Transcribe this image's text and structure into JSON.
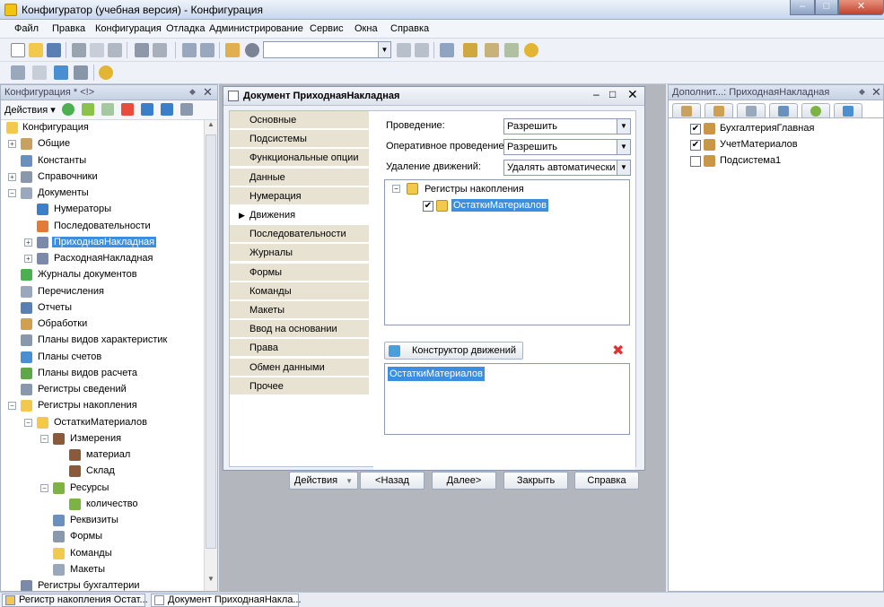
{
  "app": {
    "title": "Конфигуратор (учебная версия) - Конфигурация"
  },
  "window_controls": {
    "minimize": "–",
    "maximize": "□",
    "close": "✕"
  },
  "menu": [
    "Файл",
    "Правка",
    "Конфигурация",
    "Отладка",
    "Администрирование",
    "Сервис",
    "Окна",
    "Справка"
  ],
  "colors": {
    "selection": "#3b8ee0",
    "tab_bg": "#e8e2d2",
    "workspace": "#b3b7bd"
  },
  "left_panel": {
    "title": "Конфигурация * <!>",
    "pin": "◆",
    "close": "✕",
    "actions_label": "Действия ▾",
    "tree": [
      {
        "label": "Конфигурация",
        "icon": "config-icon",
        "exp": ""
      },
      {
        "label": "Общие",
        "icon": "common-icon",
        "exp": "+"
      },
      {
        "label": "Константы",
        "icon": "constants-icon",
        "exp": ""
      },
      {
        "label": "Справочники",
        "icon": "catalogs-icon",
        "exp": "+"
      },
      {
        "label": "Документы",
        "icon": "documents-icon",
        "exp": "−"
      },
      {
        "label": "Нумераторы",
        "icon": "numerators-icon",
        "exp": ""
      },
      {
        "label": "Последовательности",
        "icon": "sequences-icon",
        "exp": ""
      },
      {
        "label": "ПриходнаяНакладная",
        "icon": "document-icon",
        "exp": "+",
        "selected": true
      },
      {
        "label": "РасходнаяНакладная",
        "icon": "document-icon",
        "exp": "+"
      },
      {
        "label": "Журналы документов",
        "icon": "journals-icon",
        "exp": ""
      },
      {
        "label": "Перечисления",
        "icon": "enums-icon",
        "exp": ""
      },
      {
        "label": "Отчеты",
        "icon": "reports-icon",
        "exp": ""
      },
      {
        "label": "Обработки",
        "icon": "processing-icon",
        "exp": ""
      },
      {
        "label": "Планы видов характеристик",
        "icon": "chart-char-icon",
        "exp": ""
      },
      {
        "label": "Планы счетов",
        "icon": "chart-accounts-icon",
        "exp": ""
      },
      {
        "label": "Планы видов расчета",
        "icon": "chart-calc-icon",
        "exp": ""
      },
      {
        "label": "Регистры сведений",
        "icon": "info-registers-icon",
        "exp": ""
      },
      {
        "label": "Регистры накопления",
        "icon": "accum-registers-icon",
        "exp": "−"
      },
      {
        "label": "ОстаткиМатериалов",
        "icon": "accum-register-icon",
        "exp": "−"
      },
      {
        "label": "Измерения",
        "icon": "dimensions-icon",
        "exp": "−"
      },
      {
        "label": "материал",
        "icon": "dimension-icon",
        "exp": ""
      },
      {
        "label": "Склад",
        "icon": "dimension-icon",
        "exp": ""
      },
      {
        "label": "Ресурсы",
        "icon": "resources-icon",
        "exp": "−"
      },
      {
        "label": "количество",
        "icon": "resource-icon",
        "exp": ""
      },
      {
        "label": "Реквизиты",
        "icon": "attributes-icon",
        "exp": ""
      },
      {
        "label": "Формы",
        "icon": "forms-icon",
        "exp": ""
      },
      {
        "label": "Команды",
        "icon": "commands-icon",
        "exp": ""
      },
      {
        "label": "Макеты",
        "icon": "templates-icon",
        "exp": ""
      },
      {
        "label": "Регистры бухгалтерии",
        "icon": "accounting-registers-icon",
        "exp": ""
      }
    ]
  },
  "doc_window": {
    "title": "Документ ПриходнаяНакладная",
    "min": "‒",
    "max": "□",
    "close": "✕",
    "tabs": [
      "Основные",
      "Подсистемы",
      "Функциональные опции",
      "Данные",
      "Нумерация",
      "Движения",
      "Последовательности",
      "Журналы",
      "Формы",
      "Команды",
      "Макеты",
      "Ввод на основании",
      "Права",
      "Обмен данными",
      "Прочее"
    ],
    "active_tab_index": 5,
    "tab_arrow": "▶",
    "fields": {
      "posting": {
        "label": "Проведение:",
        "value": "Разрешить"
      },
      "online_posting": {
        "label": "Оперативное проведение:",
        "value": "Разрешить"
      },
      "delete_movements": {
        "label": "Удаление движений:",
        "value": "Удалять автоматически при"
      }
    },
    "registers_tree": {
      "group": "Регистры накопления",
      "item": "ОстаткиМатериалов",
      "checked": "✔",
      "exp": "−"
    },
    "constructor_label": "Конструктор движений",
    "delete_glyph": "✖",
    "movements": [
      "ОстаткиМатериалов"
    ],
    "buttons": {
      "actions": "Действия",
      "back": "<Назад",
      "next": "Далее>",
      "close": "Закрыть",
      "help": "Справка"
    }
  },
  "right_panel": {
    "title": "Дополнит...: ПриходнаяНакладная",
    "pin": "◆",
    "close": "✕",
    "items": [
      {
        "label": "БухгалтерияГлавная",
        "checked": "✔"
      },
      {
        "label": "УчетМатериалов",
        "checked": "✔"
      },
      {
        "label": "Подсистема1",
        "checked": ""
      }
    ]
  },
  "status_tabs": [
    "Регистр накопления Остат...",
    "Документ ПриходнаяНакла..."
  ],
  "dropdown_arrow": "▼"
}
